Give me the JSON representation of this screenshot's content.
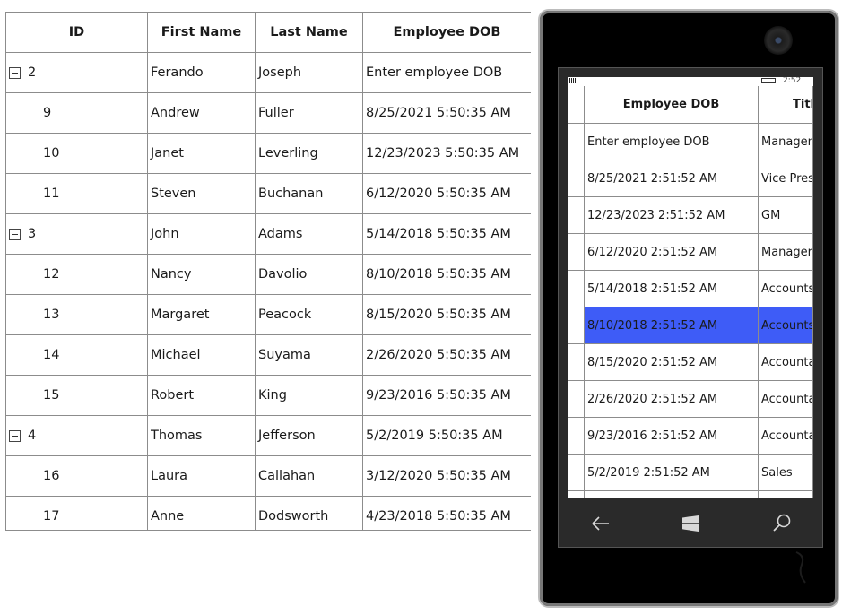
{
  "desktop_grid": {
    "headers": {
      "id": "ID",
      "first_name": "First Name",
      "last_name": "Last Name",
      "dob": "Employee DOB"
    },
    "rows": [
      {
        "id": "2",
        "first_name": "Ferando",
        "last_name": "Joseph",
        "dob": "Enter employee DOB",
        "parent": true
      },
      {
        "id": "9",
        "first_name": "Andrew",
        "last_name": "Fuller",
        "dob": "8/25/2021 5:50:35 AM",
        "parent": false
      },
      {
        "id": "10",
        "first_name": "Janet",
        "last_name": "Leverling",
        "dob": "12/23/2023 5:50:35 AM",
        "parent": false
      },
      {
        "id": "11",
        "first_name": "Steven",
        "last_name": "Buchanan",
        "dob": "6/12/2020 5:50:35 AM",
        "parent": false
      },
      {
        "id": "3",
        "first_name": "John",
        "last_name": "Adams",
        "dob": "5/14/2018 5:50:35 AM",
        "parent": true
      },
      {
        "id": "12",
        "first_name": "Nancy",
        "last_name": "Davolio",
        "dob": "8/10/2018 5:50:35 AM",
        "parent": false
      },
      {
        "id": "13",
        "first_name": "Margaret",
        "last_name": "Peacock",
        "dob": "8/15/2020 5:50:35 AM",
        "parent": false
      },
      {
        "id": "14",
        "first_name": "Michael",
        "last_name": "Suyama",
        "dob": "2/26/2020 5:50:35 AM",
        "parent": false
      },
      {
        "id": "15",
        "first_name": "Robert",
        "last_name": "King",
        "dob": "9/23/2016 5:50:35 AM",
        "parent": false
      },
      {
        "id": "4",
        "first_name": "Thomas",
        "last_name": "Jefferson",
        "dob": "5/2/2019 5:50:35 AM",
        "parent": true
      },
      {
        "id": "16",
        "first_name": "Laura",
        "last_name": "Callahan",
        "dob": "3/12/2020 5:50:35 AM",
        "parent": false
      },
      {
        "id": "17",
        "first_name": "Anne",
        "last_name": "Dodsworth",
        "dob": "4/23/2018 5:50:35 AM",
        "parent": false
      }
    ]
  },
  "phone": {
    "status_time": "2:52",
    "grid": {
      "headers": {
        "dob": "Employee DOB",
        "title": "Title"
      },
      "rows": [
        {
          "dob": "Enter employee DOB",
          "title": "Management"
        },
        {
          "dob": "8/25/2021 2:51:52 AM",
          "title": "Vice President"
        },
        {
          "dob": "12/23/2023 2:51:52 AM",
          "title": "GM"
        },
        {
          "dob": "6/12/2020 2:51:52 AM",
          "title": "Manager"
        },
        {
          "dob": "5/14/2018 2:51:52 AM",
          "title": "Accounts"
        },
        {
          "dob": "8/10/2018 2:51:52 AM",
          "title": "Accounts",
          "selected": true
        },
        {
          "dob": "8/15/2020 2:51:52 AM",
          "title": "Accountant"
        },
        {
          "dob": "2/26/2020 2:51:52 AM",
          "title": "Accountant"
        },
        {
          "dob": "9/23/2016 2:51:52 AM",
          "title": "Accountant"
        },
        {
          "dob": "5/2/2019 2:51:52 AM",
          "title": "Sales"
        },
        {
          "dob": "",
          "title": ""
        }
      ]
    },
    "nav": {
      "back": "back-arrow-icon",
      "home": "windows-logo-icon",
      "search": "search-icon"
    },
    "selection_color": "#3e5cf7"
  }
}
